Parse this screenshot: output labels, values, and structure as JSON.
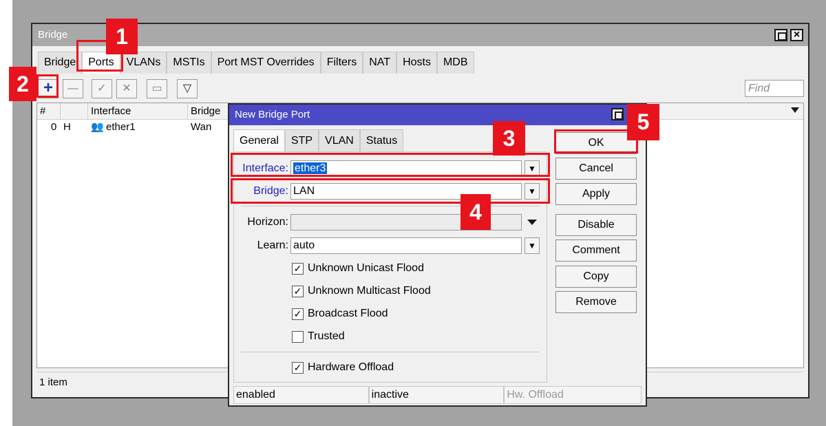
{
  "window": {
    "title": "Bridge",
    "tabs": [
      "Bridge",
      "Ports",
      "VLANs",
      "MSTIs",
      "Port MST Overrides",
      "Filters",
      "NAT",
      "Hosts",
      "MDB"
    ],
    "find_placeholder": "Find",
    "table": {
      "columns": [
        "#",
        "",
        "Interface",
        "Bridge"
      ],
      "rows": [
        {
          "num": "0",
          "flag": "H",
          "interface": "ether1",
          "bridge": "Wan"
        }
      ]
    },
    "status": "1 item"
  },
  "dialog": {
    "title": "New Bridge Port",
    "tabs": [
      "General",
      "STP",
      "VLAN",
      "Status"
    ],
    "fields": {
      "interface_label": "Interface:",
      "interface_value": "ether3",
      "bridge_label": "Bridge:",
      "bridge_value": "LAN",
      "horizon_label": "Horizon:",
      "horizon_value": "",
      "learn_label": "Learn:",
      "learn_value": "auto"
    },
    "checkboxes": [
      {
        "label": "Unknown Unicast Flood",
        "checked": true
      },
      {
        "label": "Unknown Multicast Flood",
        "checked": true
      },
      {
        "label": "Broadcast Flood",
        "checked": true
      },
      {
        "label": "Trusted",
        "checked": false
      },
      {
        "label": "Hardware Offload",
        "checked": true
      }
    ],
    "buttons": [
      "OK",
      "Cancel",
      "Apply",
      "Disable",
      "Comment",
      "Copy",
      "Remove"
    ],
    "status": [
      "enabled",
      "inactive",
      "Hw. Offload"
    ]
  },
  "annotations": [
    "1",
    "2",
    "3",
    "4",
    "5"
  ],
  "colors": {
    "annotation_red": "#e8141d",
    "dialog_title": "#4a4ac6",
    "selection": "#0a64d6"
  }
}
